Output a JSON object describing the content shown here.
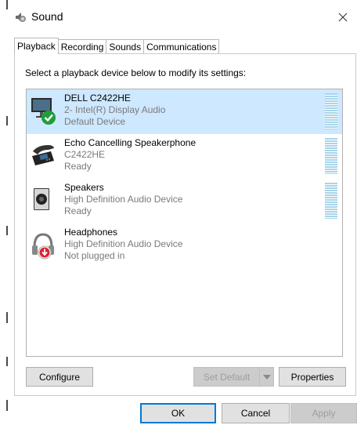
{
  "window": {
    "title": "Sound",
    "close_glyph": "✕"
  },
  "tabs": [
    {
      "label": "Playback",
      "active": true
    },
    {
      "label": "Recording",
      "active": false
    },
    {
      "label": "Sounds",
      "active": false
    },
    {
      "label": "Communications",
      "active": false
    }
  ],
  "panel": {
    "instruction": "Select a playback device below to modify its settings:"
  },
  "devices": [
    {
      "name": "DELL C2422HE",
      "description": "2- Intel(R) Display Audio",
      "status": "Default Device",
      "icon": "monitor-default-icon",
      "selected": true
    },
    {
      "name": "Echo Cancelling Speakerphone",
      "description": "C2422HE",
      "status": "Ready",
      "icon": "speakerphone-icon",
      "selected": false
    },
    {
      "name": "Speakers",
      "description": "High Definition Audio Device",
      "status": "Ready",
      "icon": "speaker-icon",
      "selected": false
    },
    {
      "name": "Headphones",
      "description": "High Definition Audio Device",
      "status": "Not plugged in",
      "icon": "headphones-unplugged-icon",
      "selected": false
    }
  ],
  "buttons": {
    "configure": "Configure",
    "set_default": "Set Default",
    "properties": "Properties",
    "ok": "OK",
    "cancel": "Cancel",
    "apply": "Apply"
  },
  "colors": {
    "selection": "#cde8ff",
    "meter": "#a9d5e9",
    "default_check": "#1f9e3a",
    "unplugged": "#d9232e",
    "focus_border": "#0078d7"
  }
}
